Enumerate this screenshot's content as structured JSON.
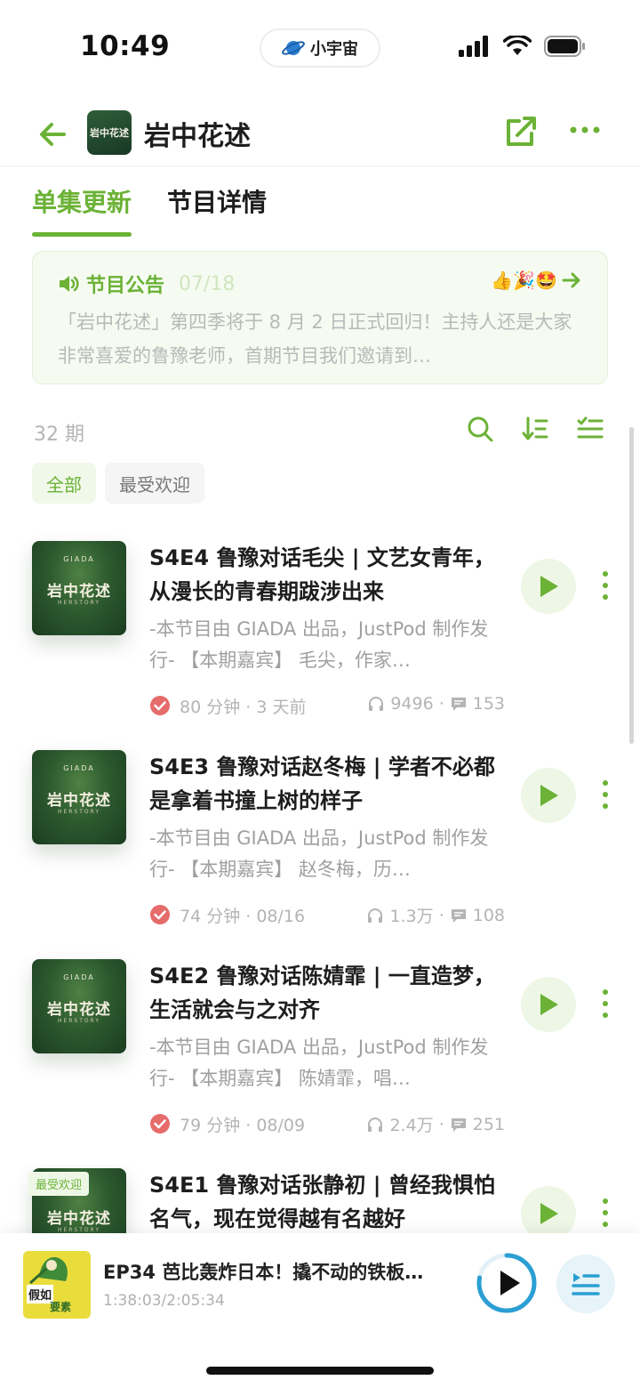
{
  "status_bar": {
    "time": "10:49",
    "app_name": "小宇宙"
  },
  "header": {
    "cover_text": "岩中花述",
    "title": "岩中花述"
  },
  "tabs": [
    {
      "label": "单集更新",
      "active": true
    },
    {
      "label": "节目详情",
      "active": false
    }
  ],
  "notice": {
    "title": "节目公告",
    "date": "07/18",
    "emoji": "👍🎉🤩",
    "body": "「岩中花述」第四季将于 8 月 2 日正式回归！主持人还是大家非常喜爱的鲁豫老师，首期节目我们邀请到…"
  },
  "list": {
    "count": "32 期",
    "filters": [
      "全部",
      "最受欢迎"
    ]
  },
  "episodes": [
    {
      "cover_brand": "GIADA",
      "cover_name": "岩中花述",
      "cover_sub": "HERSTORY",
      "tag": "",
      "title": "S4E4 鲁豫对话毛尖 | 文艺女青年，从漫长的青春期跋涉出来",
      "desc": "-本节目由 GIADA 出品，JustPod 制作发行- 【本期嘉宾】 毛尖，作家…",
      "duration": "80 分钟 · 3 天前",
      "plays": "9496",
      "comments": "153"
    },
    {
      "cover_brand": "GIADA",
      "cover_name": "岩中花述",
      "cover_sub": "HERSTORY",
      "tag": "",
      "title": "S4E3 鲁豫对话赵冬梅 | 学者不必都是拿着书撞上树的样子",
      "desc": "-本节目由 GIADA 出品，JustPod 制作发行- 【本期嘉宾】 赵冬梅，历…",
      "duration": "74 分钟 · 08/16",
      "plays": "1.3万",
      "comments": "108"
    },
    {
      "cover_brand": "GIADA",
      "cover_name": "岩中花述",
      "cover_sub": "HERSTORY",
      "tag": "",
      "title": "S4E2 鲁豫对话陈婧霏 | 一直造梦，生活就会与之对齐",
      "desc": "-本节目由 GIADA 出品，JustPod 制作发行- 【本期嘉宾】 陈婧霏，唱…",
      "duration": "79 分钟 · 08/09",
      "plays": "2.4万",
      "comments": "251"
    },
    {
      "cover_brand": "",
      "cover_name": "岩中花述",
      "cover_sub": "HERSTORY",
      "tag": "最受欢迎",
      "title": "S4E1 鲁豫对话张静初 | 曾经我惧怕名气，现在觉得越有名越好",
      "desc": "",
      "duration": "",
      "plays": "",
      "comments": ""
    }
  ],
  "player": {
    "cover_text_1": "假如",
    "cover_text_2": "要素",
    "title": "EP34 芭比轰炸日本！撬不动的铁板…",
    "time": "1:38:03/2:05:34",
    "progress": 0.78
  },
  "colors": {
    "accent": "#6bb236",
    "player_accent": "#2b9fd3"
  }
}
